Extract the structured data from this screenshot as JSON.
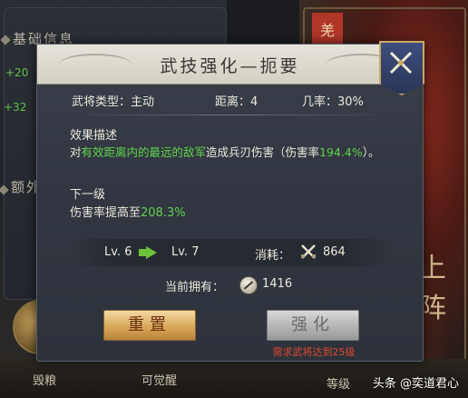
{
  "background": {
    "left_panel": {
      "section1_title": "基础信息",
      "stat1": "+20",
      "stat2": "+32",
      "section2_title": "额外"
    },
    "right_art": {
      "tag_char": "羌",
      "calligraphy": "上阵"
    },
    "bottom_bar": {
      "item1": "毁粮",
      "item2": "可觉醒",
      "item3": "等级"
    },
    "watermark": "头条 @奕道君心"
  },
  "dialog": {
    "title": "武技强化—扼要",
    "stats": {
      "type_label": "武将类型：",
      "type_value": "主动",
      "range_label": "距离：",
      "range_value": "4",
      "chance_label": "几率：",
      "chance_value": "30%"
    },
    "effect": {
      "label": "效果描述",
      "text_prefix": "对",
      "text_highlight": "有效距离内的最远的敌军",
      "text_middle": "造成兵刃伤害（伤害率",
      "text_rate": "194.4%",
      "text_suffix": "）。"
    },
    "next_level": {
      "label": "下一级",
      "text_prefix": "伤害率提高至",
      "text_value": "208.3%"
    },
    "level": {
      "current": "Lv. 6",
      "next": "Lv. 7",
      "cost_label": "消耗：",
      "cost_value": "864"
    },
    "owned": {
      "label": "当前拥有：",
      "value": "1416"
    },
    "buttons": {
      "reset": "重置",
      "enhance": "强化"
    },
    "requirement": "需求武将达到25级"
  },
  "colors": {
    "highlight_green": "#5fd24e",
    "warning_red": "#e0482e",
    "reset_gold": "#d8a85a",
    "disabled_gray": "#b4b4b4"
  },
  "icons": {
    "close": "crossed-swords-close-icon",
    "cost": "crossed-blades-icon",
    "owned": "token-coin-icon",
    "level_arrow": "right-arrow-icon"
  }
}
